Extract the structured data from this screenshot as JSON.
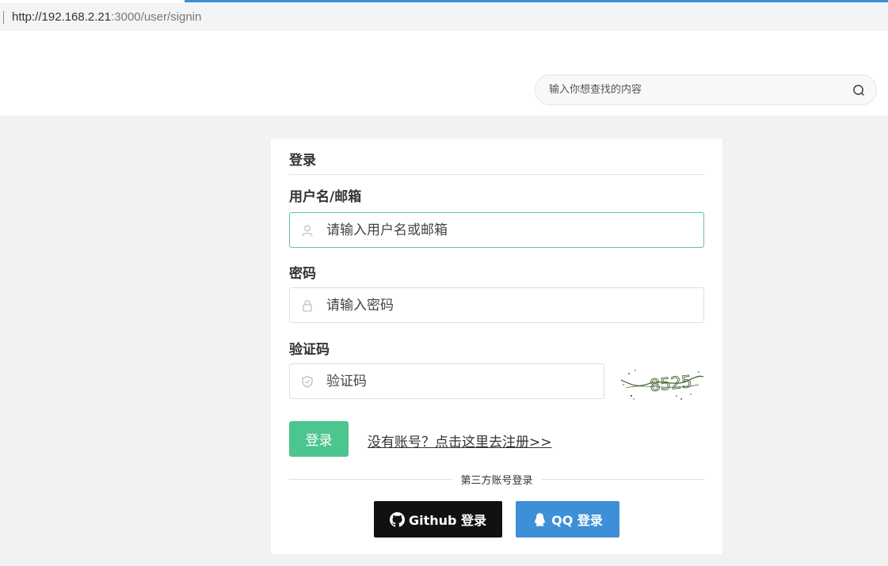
{
  "browser": {
    "url_host": "http://192.168.2.21",
    "url_path": ":3000/user/signin"
  },
  "header": {
    "search": {
      "placeholder": "输入你想查找的内容",
      "icon": "search-icon"
    }
  },
  "login_form": {
    "title": "登录",
    "username": {
      "label": "用户名/邮箱",
      "placeholder": "请输入用户名或邮箱",
      "icon": "user-icon"
    },
    "password": {
      "label": "密码",
      "placeholder": "请输入密码",
      "icon": "lock-icon"
    },
    "captcha": {
      "label": "验证码",
      "placeholder": "验证码",
      "icon": "shield-icon",
      "image_text": "8525"
    },
    "submit_label": "登录",
    "register_link": "没有账号？点击这里去注册>>",
    "third_party_label": "第三方账号登录",
    "github_button": "Github 登录",
    "qq_button": "QQ 登录"
  },
  "colors": {
    "accent_green": "#4cc58e",
    "qq_blue": "#3d8fd8",
    "github_black": "#111111",
    "page_background": "#f2f2f2"
  }
}
